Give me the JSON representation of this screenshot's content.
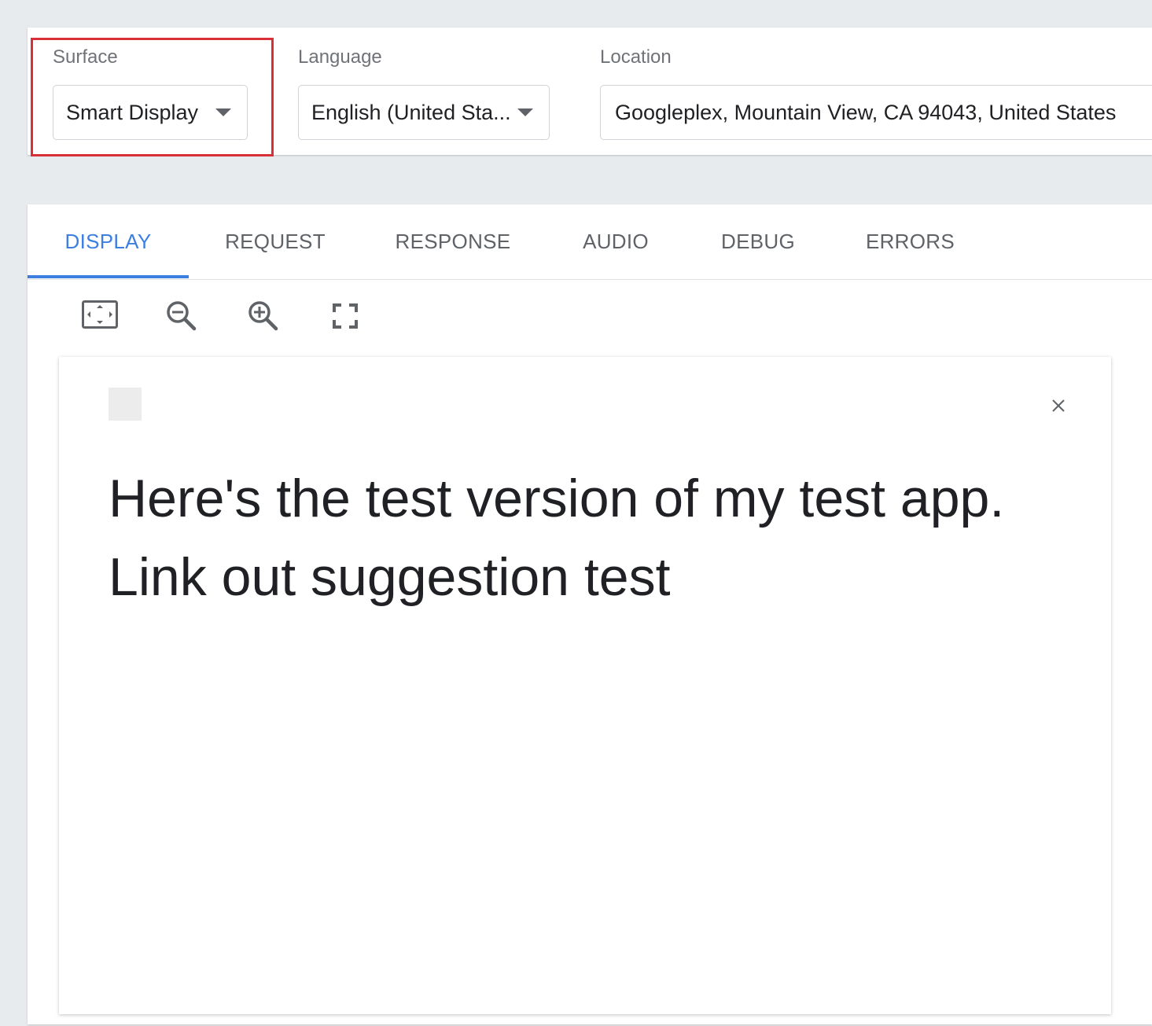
{
  "settings": {
    "surface": {
      "label": "Surface",
      "value": "Smart Display"
    },
    "language": {
      "label": "Language",
      "value": "English (United Sta..."
    },
    "location": {
      "label": "Location",
      "value": "Googleplex, Mountain View, CA 94043, United States"
    }
  },
  "tabs": [
    {
      "label": "DISPLAY",
      "active": true
    },
    {
      "label": "REQUEST",
      "active": false
    },
    {
      "label": "RESPONSE",
      "active": false
    },
    {
      "label": "AUDIO",
      "active": false
    },
    {
      "label": "DEBUG",
      "active": false
    },
    {
      "label": "ERRORS",
      "active": false
    }
  ],
  "toolbar": {
    "icons": [
      "fit-screen-icon",
      "zoom-out-icon",
      "zoom-in-icon",
      "fullscreen-icon"
    ]
  },
  "display": {
    "lines": [
      "Here's the test version of my test app.",
      "Link out suggestion test"
    ]
  },
  "colors": {
    "accent": "#3d7fe1",
    "highlight": "#d93037",
    "background": "#e8ebee"
  }
}
